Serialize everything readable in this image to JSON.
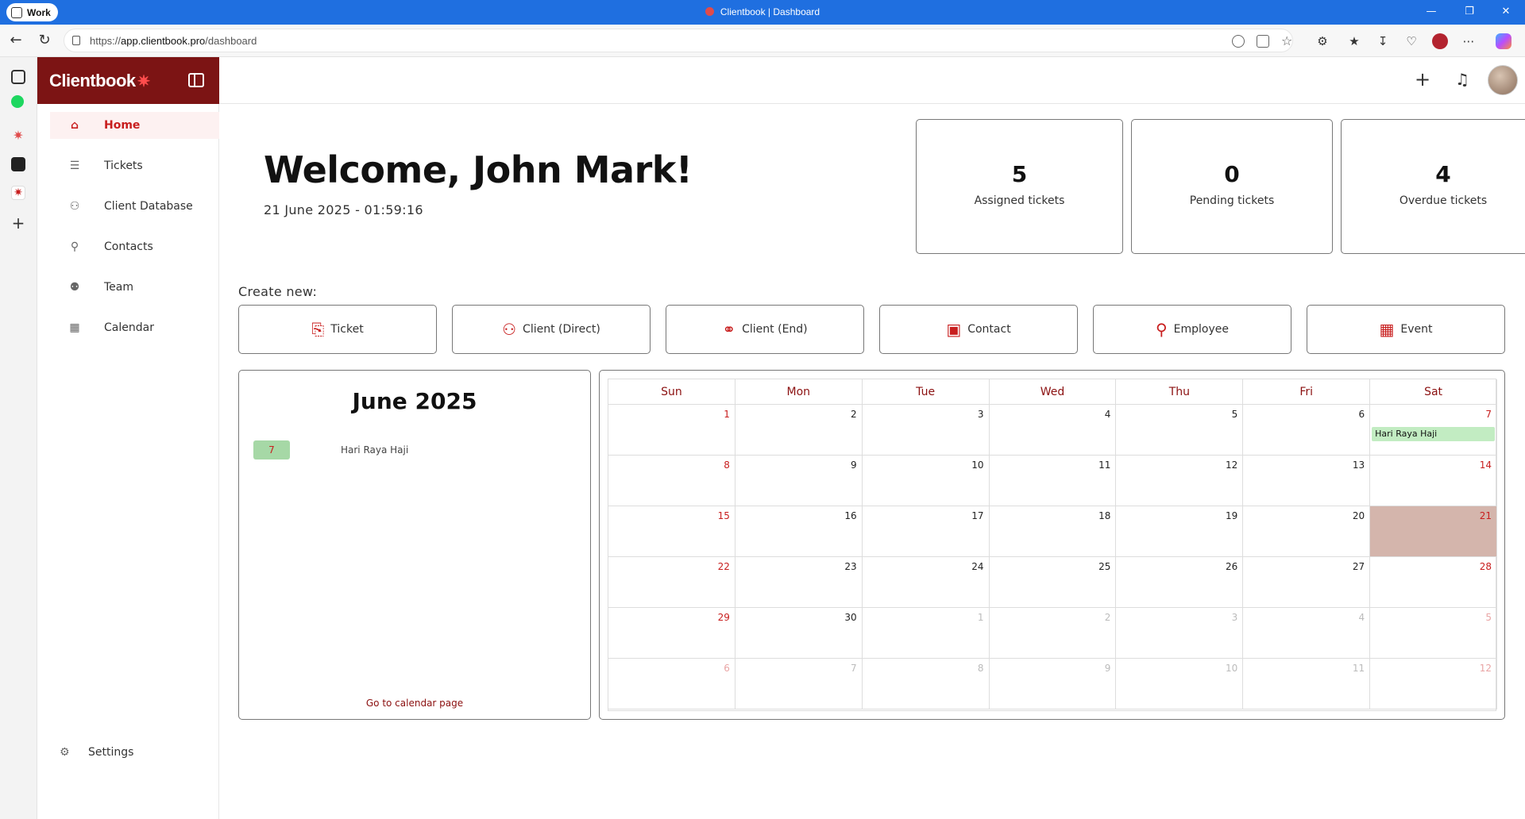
{
  "browser": {
    "profile_label": "Work",
    "window_title": "Clientbook | Dashboard",
    "url_prefix": "https://",
    "url_host": "app.clientbook.pro",
    "url_path": "/dashboard"
  },
  "app": {
    "brand": "Clientbook",
    "brand_mark": "✷"
  },
  "sidebar": {
    "items": [
      {
        "label": "Home",
        "icon": "home-icon",
        "glyph": "⌂"
      },
      {
        "label": "Tickets",
        "icon": "list-icon",
        "glyph": "☰"
      },
      {
        "label": "Client Database",
        "icon": "users-icon",
        "glyph": "⚇"
      },
      {
        "label": "Contacts",
        "icon": "user-plus-icon",
        "glyph": "⚲"
      },
      {
        "label": "Team",
        "icon": "team-icon",
        "glyph": "⚉"
      },
      {
        "label": "Calendar",
        "icon": "calendar-icon",
        "glyph": "▦"
      }
    ],
    "settings_label": "Settings"
  },
  "main": {
    "welcome": "Welcome, John Mark!",
    "datetime": "21 June 2025 - 01:59:16",
    "stats": [
      {
        "value": "5",
        "label": "Assigned tickets"
      },
      {
        "value": "0",
        "label": "Pending tickets"
      },
      {
        "value": "4",
        "label": "Overdue tickets"
      }
    ],
    "create_label": "Create new:",
    "create_buttons": [
      {
        "label": "Ticket",
        "icon": "ticket-icon",
        "glyph": "⎘"
      },
      {
        "label": "Client (Direct)",
        "icon": "client-group-icon",
        "glyph": "⚇"
      },
      {
        "label": "Client (End)",
        "icon": "handshake-icon",
        "glyph": "⚭"
      },
      {
        "label": "Contact",
        "icon": "contact-book-icon",
        "glyph": "▣"
      },
      {
        "label": "Employee",
        "icon": "user-add-icon",
        "glyph": "⚲"
      },
      {
        "label": "Event",
        "icon": "calendar-add-icon",
        "glyph": "▦"
      }
    ]
  },
  "mini_calendar": {
    "title": "June 2025",
    "events": [
      {
        "date": "7",
        "name": "Hari Raya Haji"
      }
    ],
    "link": "Go to calendar page"
  },
  "calendar": {
    "weekdays": [
      "Sun",
      "Mon",
      "Tue",
      "Wed",
      "Thu",
      "Fri",
      "Sat"
    ],
    "weeks": [
      [
        "1",
        "2",
        "3",
        "4",
        "5",
        "6",
        "7"
      ],
      [
        "8",
        "9",
        "10",
        "11",
        "12",
        "13",
        "14"
      ],
      [
        "15",
        "16",
        "17",
        "18",
        "19",
        "20",
        "21"
      ],
      [
        "22",
        "23",
        "24",
        "25",
        "26",
        "27",
        "28"
      ],
      [
        "29",
        "30",
        "1",
        "2",
        "3",
        "4",
        "5"
      ],
      [
        "6",
        "7",
        "8",
        "9",
        "10",
        "11",
        "12"
      ]
    ],
    "today": "21",
    "events": [
      {
        "day": "7",
        "label": "Hari Raya Haji"
      }
    ]
  },
  "colors": {
    "brand_dark": "#7c1414",
    "accent": "#c81e1e",
    "today_bg": "#d4b5ac",
    "event_bg": "#c2ecc2"
  }
}
